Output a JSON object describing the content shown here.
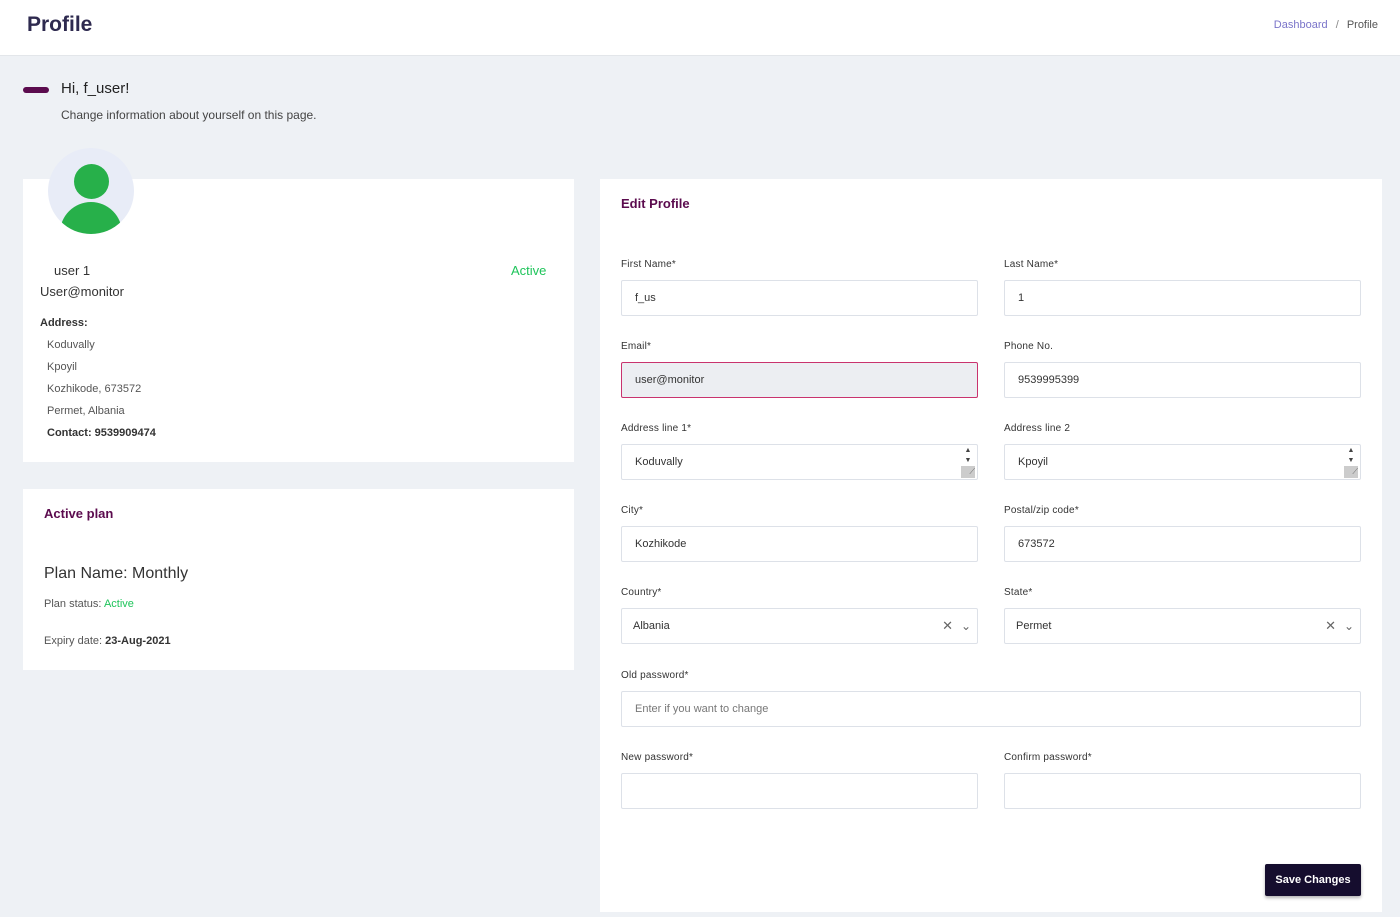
{
  "header": {
    "title": "Profile",
    "breadcrumb": {
      "link": "Dashboard",
      "separator": "/",
      "current": "Profile"
    }
  },
  "greeting": {
    "title": "Hi, f_user!",
    "subtitle": "Change information about yourself on this page."
  },
  "profile_card": {
    "name": "user 1",
    "status": "Active",
    "email": "User@monitor",
    "address_label": "Address:",
    "address_lines": [
      "Koduvally",
      "Kpoyil",
      "Kozhikode, 673572",
      "Permet, Albania"
    ],
    "contact": "Contact: 9539909474"
  },
  "plan_card": {
    "title": "Active plan",
    "plan_name": "Plan Name: Monthly",
    "status_label": "Plan status:",
    "status_value": "Active",
    "expiry_label": "Expiry date:",
    "expiry_value": "23-Aug-2021"
  },
  "edit_profile": {
    "title": "Edit Profile",
    "first_name": {
      "label": "First Name*",
      "value": "f_us"
    },
    "last_name": {
      "label": "Last Name*",
      "value": "1"
    },
    "email": {
      "label": "Email*",
      "value": "user@monitor"
    },
    "phone": {
      "label": "Phone No.",
      "value": "9539995399"
    },
    "address1": {
      "label": "Address line 1*",
      "value": "Koduvally"
    },
    "address2": {
      "label": "Address line 2",
      "value": "Kpoyil"
    },
    "city": {
      "label": "City*",
      "value": "Kozhikode"
    },
    "postal": {
      "label": "Postal/zip code*",
      "value": "673572"
    },
    "country": {
      "label": "Country*",
      "value": "Albania"
    },
    "state": {
      "label": "State*",
      "value": "Permet"
    },
    "old_password": {
      "label": "Old password*",
      "placeholder": "Enter if you want to change"
    },
    "new_password": {
      "label": "New password*",
      "value": ""
    },
    "confirm_password": {
      "label": "Confirm password*",
      "value": ""
    },
    "save_label": "Save Changes"
  },
  "colors": {
    "accent": "#5b0b4e",
    "active_green": "#1ec45a",
    "button_bg": "#150d2e",
    "avatar_green": "#27b04a"
  }
}
